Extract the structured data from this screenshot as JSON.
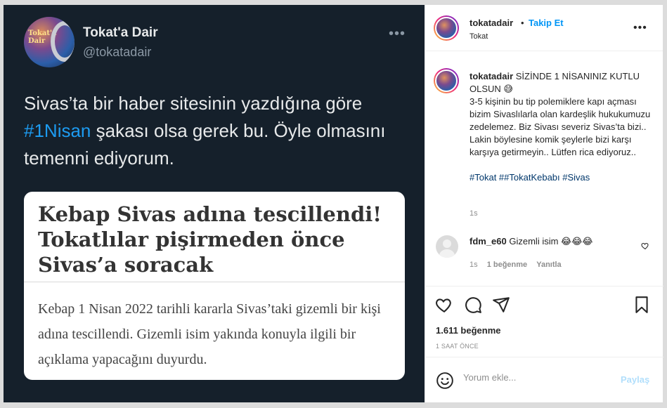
{
  "tweet": {
    "display_name": "Tokat'a Dair",
    "handle": "@tokatadair",
    "avatar_text": "Tokat'a Dair",
    "more_label": "•••",
    "text_before_tag": "Sivas’ta bir haber sitesinin yazdığına göre ",
    "hashtag": "#1Nisan",
    "text_after_tag": " şakası olsa gerek bu. Öyle olmasını temenni ediyorum.",
    "card": {
      "headline": "Kebap Sivas adına tescillendi! Tokatlılar pişirmeden önce Sivas’a soracak",
      "body": "Kebap 1 Nisan 2022 tarihli kararla Sivas’taki gizemli bir kişi adına tescillendi. Gizemli isim yakında konuyla ilgili bir açıklama yapacağını duyurdu."
    }
  },
  "post": {
    "username": "tokatadair",
    "dot": "•",
    "follow_label": "Takip Et",
    "location": "Tokat",
    "more_label": "•••",
    "caption": {
      "username": "tokatadair",
      "line1": "SİZİNDE 1 NİSANINIZ KUTLU OLSUN 😅",
      "line2": "3-5 kişinin bu tip polemiklere kapı açması bizim Sivaslılarla olan kardeşlik hukukumuzu zedelemez. Biz Sivası severiz Sivas’ta bizi.. Lakin böylesine komik şeylerle bizi karşı karşıya getirmeyin.. Lütfen rica ediyoruz..",
      "hashtags": "#Tokat ##TokatKebabı #Sivas",
      "time": "1s"
    },
    "comment": {
      "username": "fdm_e60",
      "text": "Gizemli isim 😂😂😂",
      "time": "1s",
      "likes": "1 beğenme",
      "reply": "Yanıtla"
    },
    "likes": "1.611 beğenme",
    "ago": "1 SAAT ÖNCE",
    "comment_placeholder": "Yorum ekle...",
    "post_label": "Paylaş"
  },
  "colors": {
    "tweet_bg": "#15202b",
    "link_blue": "#1d9bf0",
    "follow_blue": "#0095f6"
  }
}
